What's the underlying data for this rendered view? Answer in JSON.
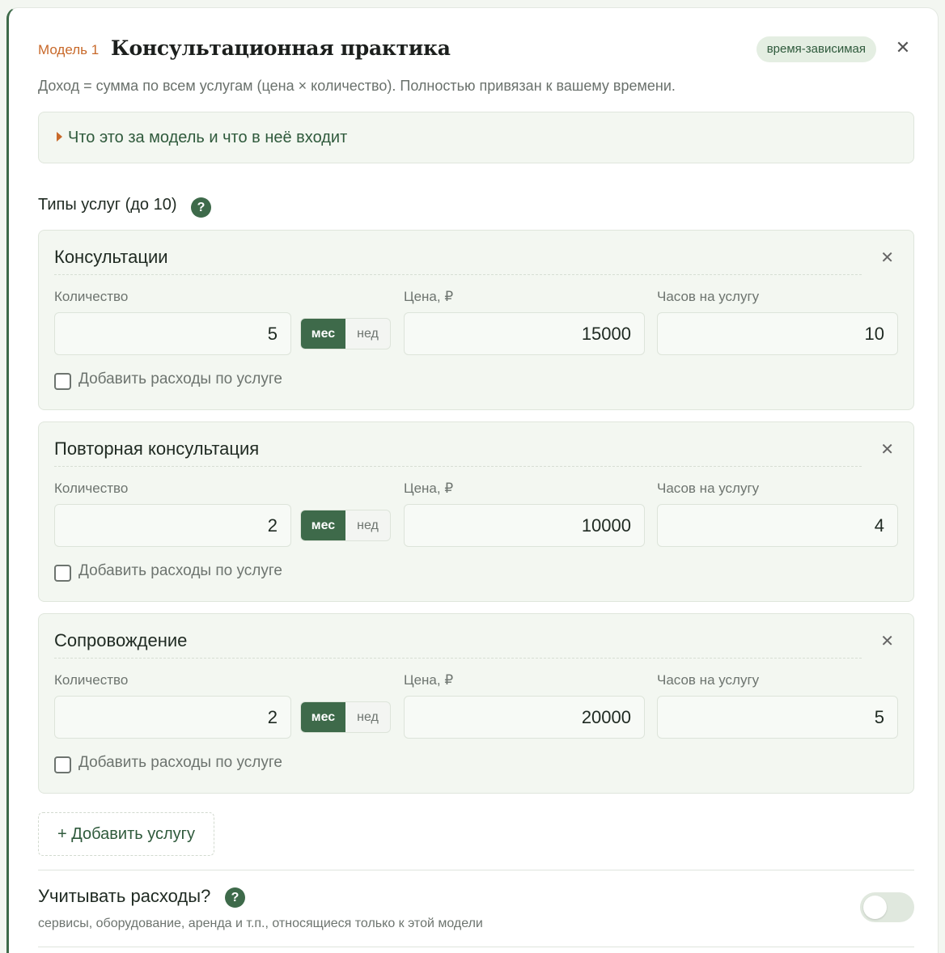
{
  "model": {
    "number_label": "Модель 1",
    "title": "Консультационная практика",
    "badge": "время-зависимая",
    "subtitle": "Доход = сумма по всем услугам (цена × количество). Полностью привязан к вашему времени.",
    "details_label": "Что это за модель и что в неё входит"
  },
  "services_section": {
    "title": "Типы услуг (до 10)",
    "help": "?"
  },
  "labels": {
    "quantity": "Количество",
    "price": "Цена, ₽",
    "hours": "Часов на услугу",
    "month": "мес",
    "week": "нед",
    "add_expenses": "Добавить расходы по услуге",
    "close": "✕"
  },
  "services": [
    {
      "name": "Консультации",
      "quantity": "5",
      "period": "мес",
      "price": "15000",
      "hours": "10"
    },
    {
      "name": "Повторная консультация",
      "quantity": "2",
      "period": "мес",
      "price": "10000",
      "hours": "4"
    },
    {
      "name": "Сопровождение",
      "quantity": "2",
      "period": "мес",
      "price": "20000",
      "hours": "5"
    }
  ],
  "add_service_label": "+ Добавить услугу",
  "expenses": {
    "title": "Учитывать расходы?",
    "help": "?",
    "subtitle": "сервисы, оборудование, аренда и т.п., относящиеся только к этой модели",
    "enabled": false
  }
}
